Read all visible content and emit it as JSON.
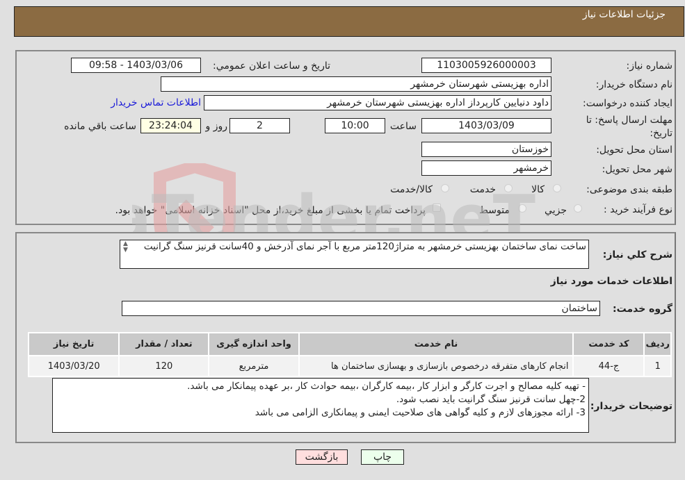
{
  "header": {
    "title": "جزئیات اطلاعات نیاز"
  },
  "form": {
    "need_number": {
      "label": "شماره نیاز:",
      "value": "1103005926000003"
    },
    "announce_datetime": {
      "label": "تاریخ و ساعت اعلان عمومي:",
      "value": "1403/03/06 - 09:58"
    },
    "buyer_org": {
      "label": "نام دستگاه خريدار:",
      "value": "اداره بهزیستی شهرستان خرمشهر"
    },
    "requester": {
      "label": "ایجاد کننده درخواست:",
      "value": "داود دنیایین کارپرداز اداره بهزیستی شهرستان خرمشهر"
    },
    "contact_link": "اطلاعات تماس خريدار",
    "deadline": {
      "label": "مهلت ارسال پاسخ: تا تاریخ:",
      "date": "1403/03/09",
      "time_label": "ساعت",
      "time": "10:00",
      "days": "2",
      "days_label": "روز و",
      "remaining": "23:24:04",
      "remaining_label": "ساعت باقي مانده"
    },
    "province": {
      "label": "استان محل تحویل:",
      "value": "خوزستان"
    },
    "city": {
      "label": "شهر محل تحویل:",
      "value": "خرمشهر"
    },
    "category": {
      "label": "طبقه بندی موضوعی:",
      "options": [
        "کالا",
        "خدمت",
        "کالا/خدمت"
      ],
      "selected": null
    },
    "process": {
      "label": "نوع فرآیند خرید :",
      "options": [
        "جزیي",
        "متوسط"
      ],
      "selected": null,
      "treasury_note": "پرداخت تمام یا بخشی از مبلغ خرید،از محل \"اسناد خزانه اسلامی\" خواهد بود."
    }
  },
  "summary": {
    "label": "شرح کلي نیاز:",
    "value": "ساخت نمای ساختمان بهزیستی خرمشهر به متراژ120متر مربع با آجر نمای آذرخش و 40سانت قرنیز سنگ گرانیت"
  },
  "services": {
    "section_title": "اطلاعات خدمات مورد نیاز",
    "group_label": "گروه خدمت:",
    "group_value": "ساختمان",
    "table": {
      "headers": [
        "ردیف",
        "کد خدمت",
        "نام خدمت",
        "واحد اندازه گیری",
        "تعداد / مقدار",
        "تاریخ نیاز"
      ],
      "rows": [
        [
          "1",
          "ج-44",
          "انجام کارهای متفرقه درخصوص بازسازی و بهسازی ساختمان ها",
          "مترمربع",
          "120",
          "1403/03/20"
        ]
      ]
    }
  },
  "buyer_notes": {
    "label": "توضیحات خریدار:",
    "lines": [
      "- تهیه کلیه مصالح و اجرت کارگر و ابزار کار ،بیمه کارگران ،بیمه حوادث کار ،بر عهده پیمانکار می باشد.",
      "2-چهل سانت قرنیز سنگ گرانیت باید نصب شود.",
      "3- ارائه مجوزهای لازم و کلیه گواهی های صلاحیت ایمنی و پیمانکاری الزامی می باشد"
    ]
  },
  "buttons": {
    "print": "چاپ",
    "back": "بازگشت"
  },
  "watermark": "AriaTender.neT",
  "colors": {
    "header_bg": "#8b6b42",
    "print_bg": "#ecffec",
    "back_bg": "#ffdede",
    "remaining_bg": "#ffffe4",
    "link": "#1a1ad8"
  }
}
